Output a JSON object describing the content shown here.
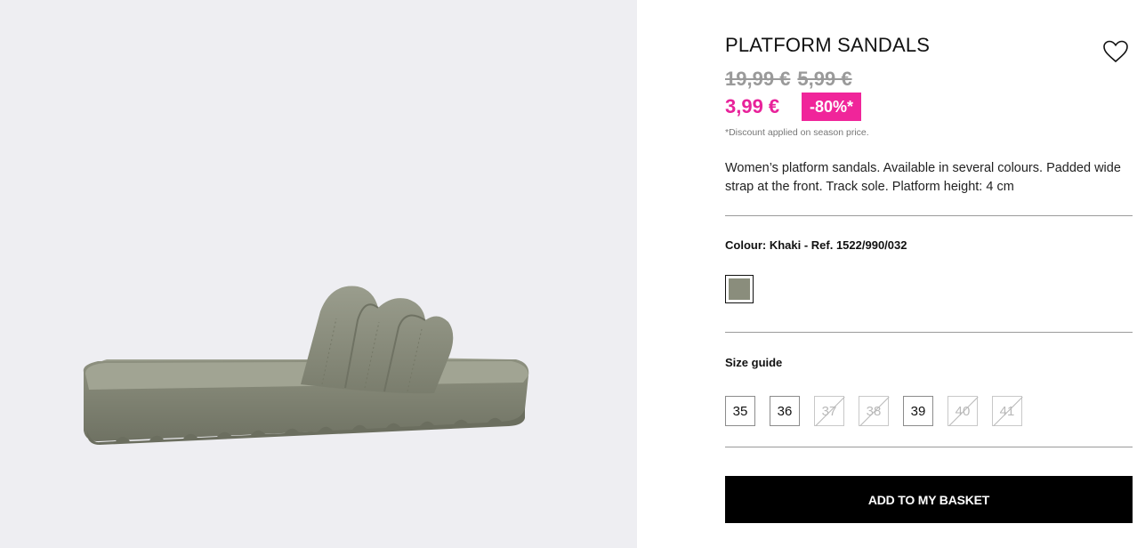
{
  "product": {
    "title": "PLATFORM SANDALS",
    "image_icon": "sandal-product-image",
    "old_prices": [
      "19,99 €",
      "5,99 €"
    ],
    "price": "3,99 €",
    "discount_badge": "-80%*",
    "disclaimer": "*Discount applied on season price.",
    "description": "Women’s platform sandals. Available in several colours. Padded wide strap at the front. Track sole. Platform height: 4 cm",
    "colour_label": "Colour: Khaki - Ref. 1522/990/032",
    "colours": [
      {
        "name": "Khaki",
        "hex": "#8a8d7c",
        "selected": true
      }
    ],
    "size_guide_label": "Size guide",
    "sizes": [
      {
        "label": "35",
        "available": true
      },
      {
        "label": "36",
        "available": true
      },
      {
        "label": "37",
        "available": false
      },
      {
        "label": "38",
        "available": false
      },
      {
        "label": "39",
        "available": true
      },
      {
        "label": "40",
        "available": false
      },
      {
        "label": "41",
        "available": false
      }
    ],
    "add_to_basket_label": "ADD TO MY BASKET",
    "wishlist_icon": "heart-icon"
  },
  "colors": {
    "price_accent": "#e8229a",
    "badge_bg": "#f0259a",
    "strike_price": "#9a9a9a",
    "gallery_bg": "#eeeef2",
    "button_bg": "#000000",
    "sandal_khaki": "#8a8d7c"
  }
}
